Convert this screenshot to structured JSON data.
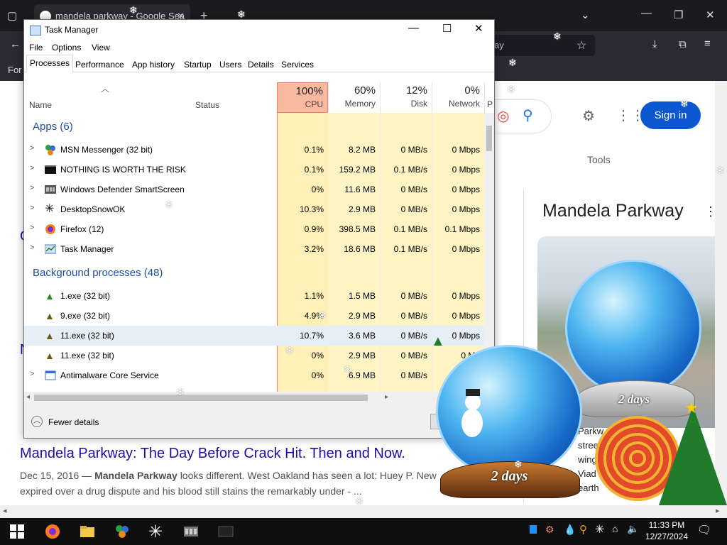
{
  "browser": {
    "tab_title": "mandela parkway - Google Sea",
    "url_fragment": "ay",
    "bookmark_fragment": "For"
  },
  "google": {
    "signin_label": "Sign in",
    "tools_label": "Tools",
    "kp_title": "Mandela Parkway",
    "kp_lines": [
      "Parkw",
      "street",
      "wing th",
      "Viad",
      "earth"
    ],
    "result_title": "Mandela Parkway: The Day Before Crack Hit. Then and Now.",
    "result_date": "Dec 15, 2016 —",
    "result_bold": "Mandela Parkway",
    "result_text_1": "looks different. West Oakland has seen a lot: Huey P. New",
    "result_text_2": "expired over a drug dispute and his blood still stains the remarkably under - ...",
    "frag_n": "N",
    "frag_o": "O"
  },
  "task_manager": {
    "title": "Task Manager",
    "menu": [
      "File",
      "Options",
      "View"
    ],
    "tabs": [
      "Processes",
      "Performance",
      "App history",
      "Startup",
      "Users",
      "Details",
      "Services"
    ],
    "active_tab": "Processes",
    "columns": {
      "name": "Name",
      "status": "Status",
      "cpu": {
        "pct": "100%",
        "label": "CPU"
      },
      "memory": {
        "pct": "60%",
        "label": "Memory"
      },
      "disk": {
        "pct": "12%",
        "label": "Disk"
      },
      "network": {
        "pct": "0%",
        "label": "Network"
      },
      "power_fragment": "P"
    },
    "apps_header": "Apps (6)",
    "background_header": "Background processes (48)",
    "apps": [
      {
        "name": "MSN Messenger (32 bit)",
        "cpu": "0.1%",
        "memory": "8.2 MB",
        "disk": "0 MB/s",
        "network": "0 Mbps",
        "icon": "msn-icon"
      },
      {
        "name": "NOTHING IS WORTH THE RISK",
        "cpu": "0.1%",
        "memory": "159.2 MB",
        "disk": "0.1 MB/s",
        "network": "0 Mbps",
        "icon": "black-window-icon"
      },
      {
        "name": "Windows Defender SmartScreen",
        "cpu": "0%",
        "memory": "11.6 MB",
        "disk": "0 MB/s",
        "network": "0 Mbps",
        "icon": "smartscreen-icon"
      },
      {
        "name": "DesktopSnowOK",
        "cpu": "10.3%",
        "memory": "2.9 MB",
        "disk": "0 MB/s",
        "network": "0 Mbps",
        "icon": "snowflake-icon"
      },
      {
        "name": "Firefox (12)",
        "cpu": "0.9%",
        "memory": "398.5 MB",
        "disk": "0.1 MB/s",
        "network": "0.1 Mbps",
        "icon": "firefox-icon"
      },
      {
        "name": "Task Manager",
        "cpu": "3.2%",
        "memory": "18.6 MB",
        "disk": "0.1 MB/s",
        "network": "0 Mbps",
        "icon": "task-manager-icon"
      }
    ],
    "background": [
      {
        "name": "1.exe (32 bit)",
        "cpu": "1.1%",
        "memory": "1.5 MB",
        "disk": "0 MB/s",
        "network": "0 Mbps",
        "icon": "tree-icon"
      },
      {
        "name": "9.exe (32 bit)",
        "cpu": "4.9%",
        "memory": "2.9 MB",
        "disk": "0 MB/s",
        "network": "0 Mbps",
        "icon": "tree-icon"
      },
      {
        "name": "11.exe (32 bit)",
        "cpu": "10.7%",
        "memory": "3.6 MB",
        "disk": "0 MB/s",
        "network": "0 Mbps",
        "icon": "tree-icon"
      },
      {
        "name": "11.exe (32 bit)",
        "cpu": "0%",
        "memory": "2.9 MB",
        "disk": "0 MB/s",
        "network": "0 Mb",
        "icon": "tree-icon"
      },
      {
        "name": "Antimalware Core Service",
        "cpu": "0%",
        "memory": "6.9 MB",
        "disk": "0 MB/s",
        "network": "",
        "icon": "antimalware-icon"
      }
    ],
    "fewer_details": "Fewer details",
    "heat_colors": {
      "cpu_header": "#f9b8a0",
      "cell": "#fff4c4",
      "cell_strong": "#ffe9a0"
    }
  },
  "globes": [
    {
      "label": "2 days"
    },
    {
      "label": "2 days"
    }
  ],
  "taskbar": {
    "time": "11:33 PM",
    "date": "12/27/2024"
  }
}
